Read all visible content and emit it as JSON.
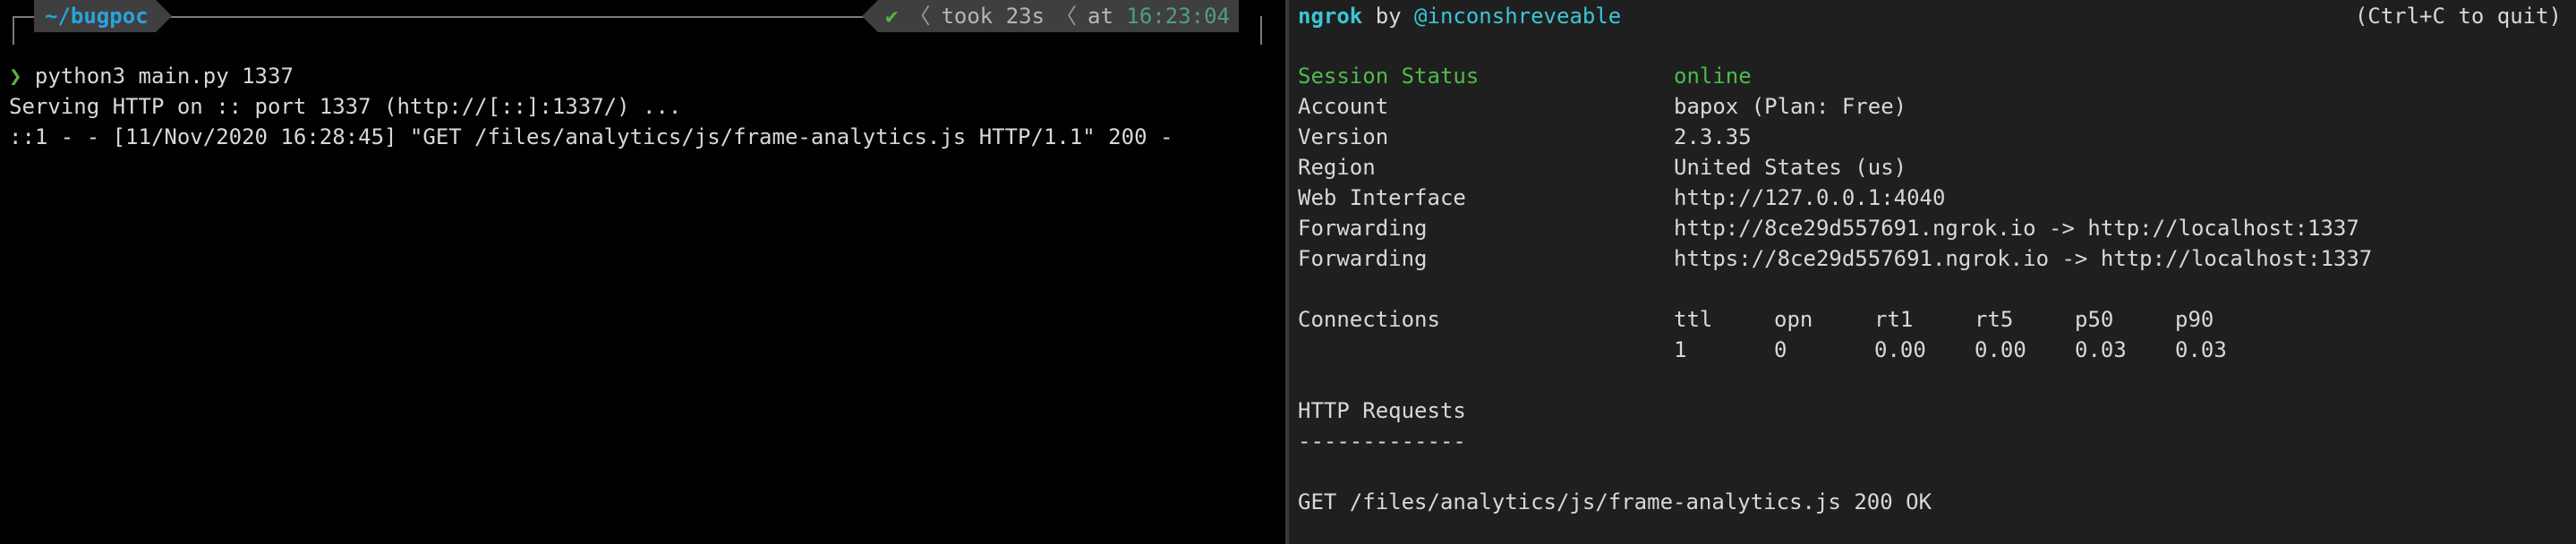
{
  "left_terminal": {
    "prompt": {
      "dir_prefix": "~/",
      "dir": "bugpoc",
      "status_check": "✔",
      "took": "took 23s",
      "at": "at",
      "time": "16:23:04"
    },
    "lines": [
      {
        "chevron": "❯",
        "text": " python3 main.py 1337"
      },
      {
        "chevron": "",
        "text": "Serving HTTP on :: port 1337 (http://[::]:1337/) ..."
      },
      {
        "chevron": "",
        "text": "::1 - - [11/Nov/2020 16:28:45] \"GET /files/analytics/js/frame-analytics.js HTTP/1.1\" 200 -"
      }
    ]
  },
  "right_terminal": {
    "header": {
      "app": "ngrok",
      "by": " by ",
      "author": "@inconshreveable",
      "quit_hint": "(Ctrl+C to quit)"
    },
    "session_status": {
      "label": "Session Status",
      "value": "online"
    },
    "info": [
      {
        "label": "Account",
        "value": "bapox (Plan: Free)"
      },
      {
        "label": "Version",
        "value": "2.3.35"
      },
      {
        "label": "Region",
        "value": "United States (us)"
      },
      {
        "label": "Web Interface",
        "value": "http://127.0.0.1:4040"
      },
      {
        "label": "Forwarding",
        "value": "http://8ce29d557691.ngrok.io -> http://localhost:1337"
      },
      {
        "label": "Forwarding",
        "value": "https://8ce29d557691.ngrok.io -> http://localhost:1337"
      }
    ],
    "connections": {
      "label": "Connections",
      "headers": [
        "ttl",
        "opn",
        "rt1",
        "rt5",
        "p50",
        "p90"
      ],
      "values": [
        "1",
        "0",
        "0.00",
        "0.00",
        "0.03",
        "0.03"
      ]
    },
    "http_requests": {
      "title": "HTTP Requests",
      "underline": "-------------",
      "entries": [
        "GET /files/analytics/js/frame-analytics.js 200 OK"
      ]
    }
  },
  "colors": {
    "prompt_dir": "#2aa3dc",
    "prompt_ok": "#5fb03b",
    "ngrok_cyan": "#3ac6d6",
    "status_online": "#4dbb4d"
  }
}
